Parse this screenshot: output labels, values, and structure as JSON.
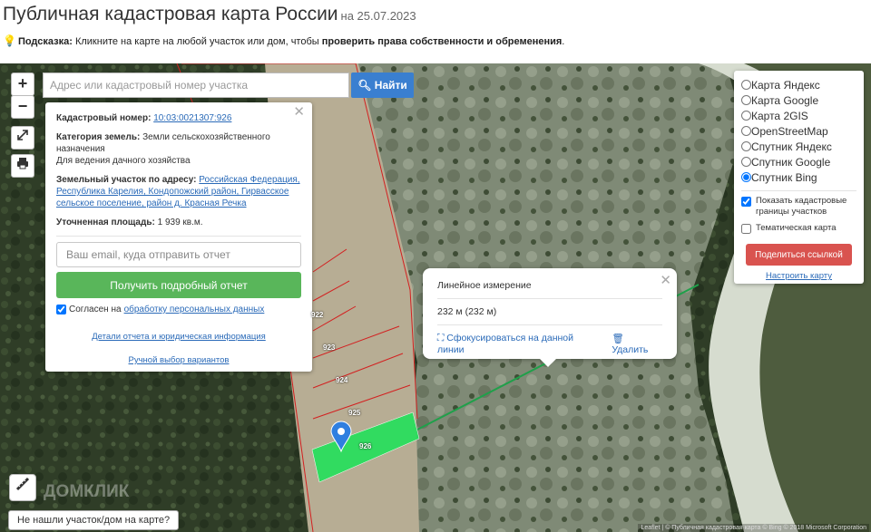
{
  "header": {
    "title": "Публичная кадастровая карта России",
    "date": "на 25.07.2023"
  },
  "hint": {
    "label": "Подсказка:",
    "text": " Кликните на карте на любой участок или дом, чтобы ",
    "emphasis": "проверить права собственности и обременения",
    "end": "."
  },
  "search": {
    "placeholder": "Адрес или кадастровый номер участка",
    "button_label": "Найти"
  },
  "info_card": {
    "cadastral_label": "Кадастровый номер:",
    "cadastral_number": "10:03:0021307:926",
    "category_label": "Категория земель:",
    "category_value": "Земли сельскохозяйственного назначения",
    "usage": "Для ведения дачного хозяйства",
    "address_label": "Земельный участок по адресу:",
    "address_value": "Российская Федерация, Республика Карелия, Кондопожский район, Гирвасское сельское поселение, район д. Красная Речка",
    "area_label": "Уточненная площадь:",
    "area_value": "1 939 кв.м.",
    "email_placeholder": "Ваш email, куда отправить отчет",
    "report_button": "Получить подробный отчет",
    "consent_prefix": "Согласен на",
    "consent_link": "обработку персональных данных",
    "details_link": "Детали отчета и юридическая информация",
    "manual_link": "Ручной выбор вариантов"
  },
  "layers": {
    "options": [
      "Карта Яндекс",
      "Карта Google",
      "Карта 2GIS",
      "OpenStreetMap",
      "Спутник Яндекс",
      "Спутник Google",
      "Спутник Bing"
    ],
    "selected": "Спутник Bing",
    "show_borders": "Показать кадастровые границы участков",
    "thematic": "Тематическая карта",
    "share_button": "Поделиться ссылкой",
    "settings_link": "Настроить карту"
  },
  "measure": {
    "title": "Линейное измерение",
    "value": "232 м (232 м)",
    "focus_link": "Сфокусироваться на данной линии",
    "delete_link": "Удалить"
  },
  "plots": [
    "922",
    "923",
    "924",
    "925",
    "926"
  ],
  "footer": {
    "not_found": "Не нашли участок/дом на карте?",
    "watermark": "ДОМКЛИК",
    "attribution": "Leaflet | © Публичная кадастровая карта © Bing © 2018 Microsoft Corporation"
  },
  "colors": {
    "accent": "#3a7fd0",
    "report_green": "#59b65a",
    "share_red": "#d9534f",
    "plot_fill": "#22e05a"
  }
}
